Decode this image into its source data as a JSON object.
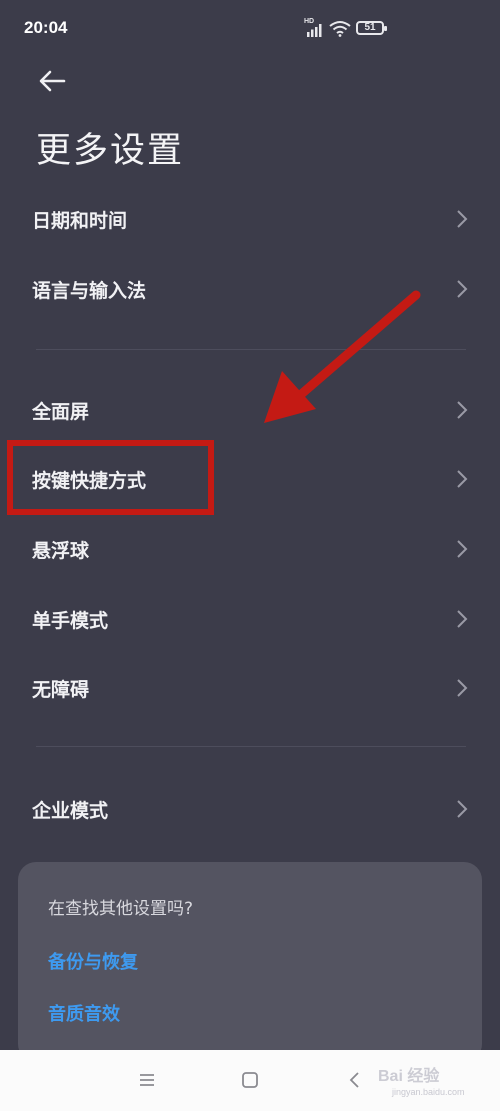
{
  "status_bar": {
    "time": "20:04",
    "network_badge": "HD",
    "battery_level": "51",
    "icons": [
      "signal-icon",
      "wifi-icon",
      "battery-icon"
    ]
  },
  "header": {
    "back_icon": "back-arrow-icon",
    "title": "更多设置"
  },
  "settings": {
    "group1": [
      {
        "label": "日期和时间"
      },
      {
        "label": "语言与输入法"
      }
    ],
    "group2": [
      {
        "label": "全面屏"
      },
      {
        "label": "按键快捷方式"
      },
      {
        "label": "悬浮球"
      },
      {
        "label": "单手模式"
      },
      {
        "label": "无障碍"
      }
    ],
    "group3": [
      {
        "label": "企业模式"
      }
    ]
  },
  "suggestion_card": {
    "question": "在查找其他设置吗?",
    "links": [
      {
        "label": "备份与恢复"
      },
      {
        "label": "音质音效"
      }
    ]
  },
  "annotation": {
    "highlight_color": "#c41a14",
    "highlighted_item": "按键快捷方式"
  },
  "nav_bar": {
    "icons": [
      "menu-icon",
      "home-icon",
      "back-icon"
    ]
  },
  "watermark": {
    "text": "Bai 经验",
    "sub": "jingyan.baidu.com"
  },
  "colors": {
    "background": "#3c3c4a",
    "card": "#545461",
    "link": "#3e9af0",
    "nav_bar": "#fbfbfb"
  }
}
